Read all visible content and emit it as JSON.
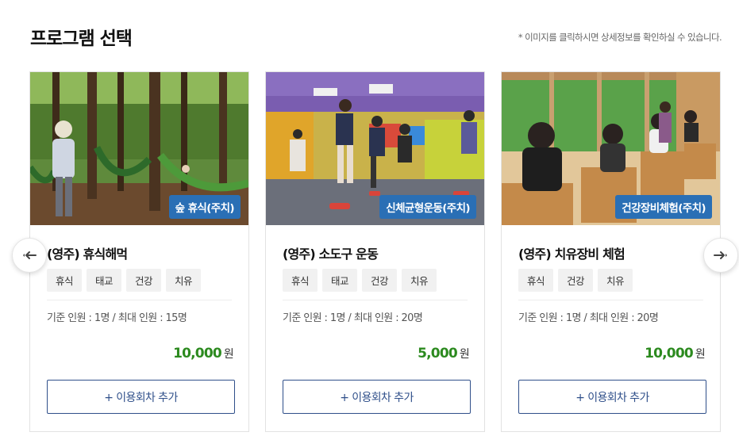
{
  "header": {
    "title": "프로그램 선택",
    "notice": "* 이미지를 클릭하시면 상세정보를 확인하실 수 있습니다."
  },
  "cards": [
    {
      "image_label": "숲 휴식(주치)",
      "name": "(영주) 휴식해먹",
      "tags": [
        "휴식",
        "태교",
        "건강",
        "치유"
      ],
      "capacity": "기준 인원 : 1명 / 최대 인원 : 15명",
      "price": "10,000",
      "price_unit": "원",
      "add_label": "+ 이용회차 추가"
    },
    {
      "image_label": "신체균형운동(주치)",
      "name": "(영주) 소도구 운동",
      "tags": [
        "휴식",
        "태교",
        "건강",
        "치유"
      ],
      "capacity": "기준 인원 : 1명 / 최대 인원 : 20명",
      "price": "5,000",
      "price_unit": "원",
      "add_label": "+ 이용회차 추가"
    },
    {
      "image_label": "건강장비체험(주치)",
      "name": "(영주) 치유장비 체험",
      "tags": [
        "휴식",
        "건강",
        "치유"
      ],
      "capacity": "기준 인원 : 1명 / 최대 인원 : 20명",
      "price": "10,000",
      "price_unit": "원",
      "add_label": "+ 이용회차 추가"
    }
  ],
  "colors": {
    "badge": "#2a6fb5",
    "price": "#2c8a1f",
    "button_border": "#2f4f8a"
  },
  "icons": {
    "prev": "arrow-left-icon",
    "next": "arrow-right-icon"
  }
}
